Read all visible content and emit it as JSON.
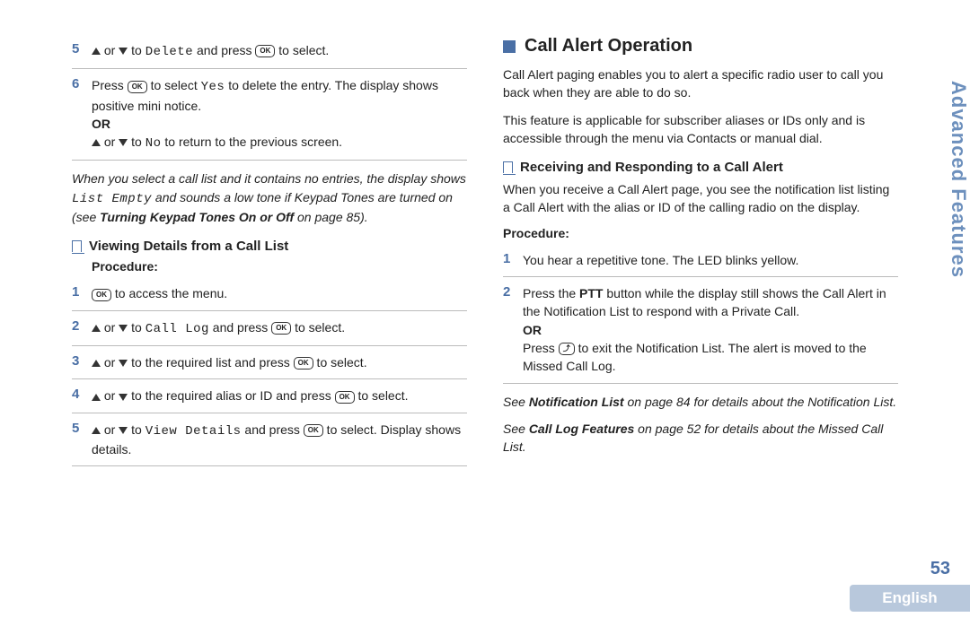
{
  "side_tab": "Advanced Features",
  "page_number": "53",
  "language": "English",
  "key_label_ok": "OK",
  "key_label_back": "⤴",
  "left": {
    "step5": {
      "num": "5",
      "t_or": " or ",
      "t_to": " to ",
      "menu_delete": "Delete",
      "t_andpress": " and press ",
      "t_toselect": " to select."
    },
    "step6": {
      "num": "6",
      "t_press": "Press ",
      "t_toselect": " to select ",
      "menu_yes": "Yes",
      "t_body": " to delete the entry. The display shows positive mini notice.",
      "or": "OR",
      "t_or2a": " or ",
      "t_or2b": " to ",
      "menu_no": "No",
      "t_or2c": " to return to the previous screen."
    },
    "note": {
      "a": "When you select a call list and it contains no entries, the display shows ",
      "mono": "List Empty",
      "b": " and sounds a low tone if Keypad Tones are turned on (see ",
      "bold": "Turning Keypad Tones On or Off",
      "c": " on page 85)."
    },
    "subhead": "Viewing Details from a Call List",
    "procedure": "Procedure:",
    "v1": {
      "num": "1",
      "t": " to access the menu."
    },
    "v2": {
      "num": "2",
      "or": " or ",
      "to": " to ",
      "menu": "Call Log",
      "andpress": " and press ",
      "tail": " to select."
    },
    "v3": {
      "num": "3",
      "or": " or ",
      "body": " to the required list and press ",
      "tail": " to select."
    },
    "v4": {
      "num": "4",
      "or": " or ",
      "body": " to the required alias or ID and press ",
      "tail": " to select."
    },
    "v5": {
      "num": "5",
      "or": " or ",
      "to": " to ",
      "menu": "View Details",
      "andpress": " and press ",
      "tail": " to select. Display shows details."
    }
  },
  "right": {
    "section": "Call Alert Operation",
    "p1": "Call Alert paging enables you to alert a specific radio user to call you back when they are able to do so.",
    "p2": "This feature is applicable for subscriber aliases or IDs only and is accessible through the menu via Contacts or manual dial.",
    "subhead": "Receiving and Responding to a Call Alert",
    "p3": "When you receive a Call Alert page, you see the notification list listing a Call Alert with the alias or ID of the calling radio on the display.",
    "procedure": "Procedure:",
    "r1": {
      "num": "1",
      "t": "You hear a repetitive tone. The LED blinks yellow."
    },
    "r2": {
      "num": "2",
      "a": "Press the ",
      "ptt": "PTT",
      "b": " button while the display still shows the Call Alert in the Notification List to respond with a Private Call.",
      "or": "OR",
      "c": "Press ",
      "d": " to exit the Notification List. The alert is moved to the Missed Call Log."
    },
    "note1": {
      "a": "See ",
      "bold": "Notification List",
      "b": " on page 84 for details about the Notification List."
    },
    "note2": {
      "a": "See ",
      "bold": "Call Log Features",
      "b": " on page 52 for details about the Missed Call List."
    }
  }
}
